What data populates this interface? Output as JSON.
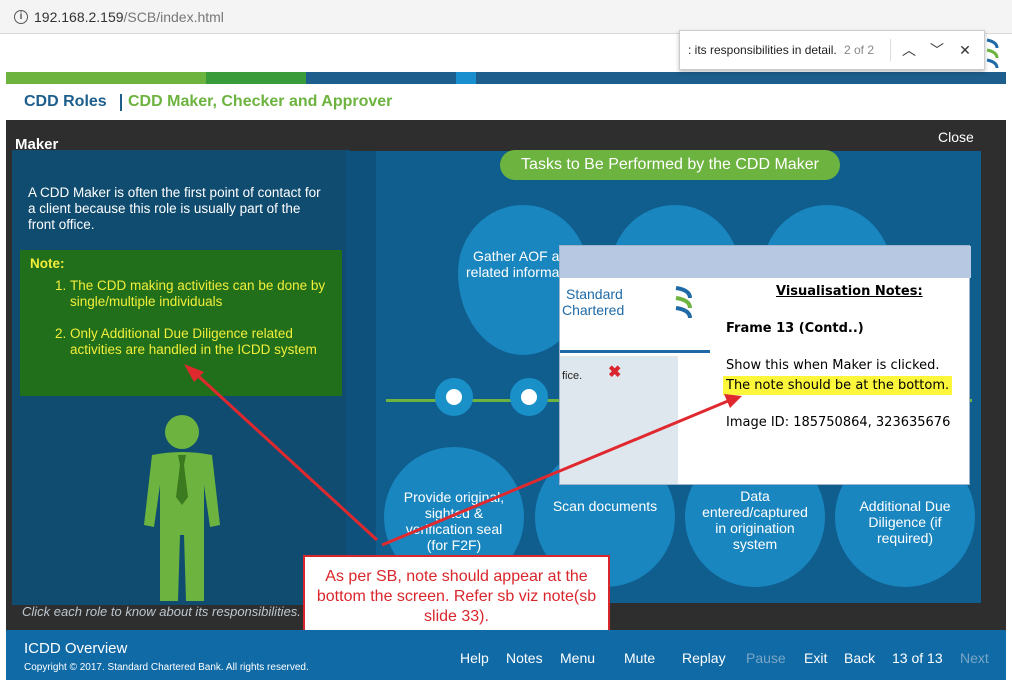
{
  "browser": {
    "url_host": "192.168.2.159",
    "url_path": "/SCB/index.html"
  },
  "find_bar": {
    "query": ": its responsibilities in detail.",
    "count": "2 of 2"
  },
  "header": {
    "breadcrumb_root": "CDD Roles",
    "breadcrumb_current": "CDD Maker, Checker and Approver"
  },
  "stripe_colors": [
    "#6db33f",
    "#3a9b3a",
    "#1a7fb8",
    "#1a8fd0",
    "#1d5e8c"
  ],
  "stage": {
    "role_title": "Maker",
    "close_label": "Close",
    "intro": "A CDD Maker is often the first point of contact for a client because this role is usually part of the front office.",
    "note_title": "Note:",
    "notes": [
      "The CDD making activities can be done by single/multiple individuals",
      "Only Additional Due Diligence related activities are handled in the ICDD system"
    ],
    "click_hint": "Click each role to know about its responsibilities."
  },
  "tasks": {
    "title": "Tasks to Be Performed by the CDD Maker",
    "top_items": [
      "Gather AOF and related information"
    ],
    "bottom_items": [
      "Provide original, sighted & verification seal (for F2F)",
      "Scan documents",
      "Data entered/captured in origination system",
      "Additional Due Diligence (if required)"
    ]
  },
  "viz_note": {
    "logo_text_1": "Standard",
    "logo_text_2": "Chartered",
    "thumb_text": "fice.",
    "title": "Visualisation Notes:",
    "frame": "Frame 13 (Contd..)",
    "line1": "Show this when Maker is clicked.",
    "line2": "The note should be at the bottom.",
    "line3": "Image ID: 185750864, 323635676"
  },
  "callout": {
    "text": "As per SB, note should appear at the bottom the screen. Refer sb viz note(sb slide 33)."
  },
  "footer": {
    "title": "ICDD Overview",
    "copyright": "Copyright © 2017. Standard Chartered Bank. All rights reserved.",
    "nav": {
      "help": "Help",
      "notes": "Notes",
      "menu": "Menu",
      "mute": "Mute",
      "replay": "Replay",
      "pause": "Pause",
      "exit": "Exit",
      "back": "Back",
      "page": "13 of 13",
      "next": "Next"
    }
  }
}
